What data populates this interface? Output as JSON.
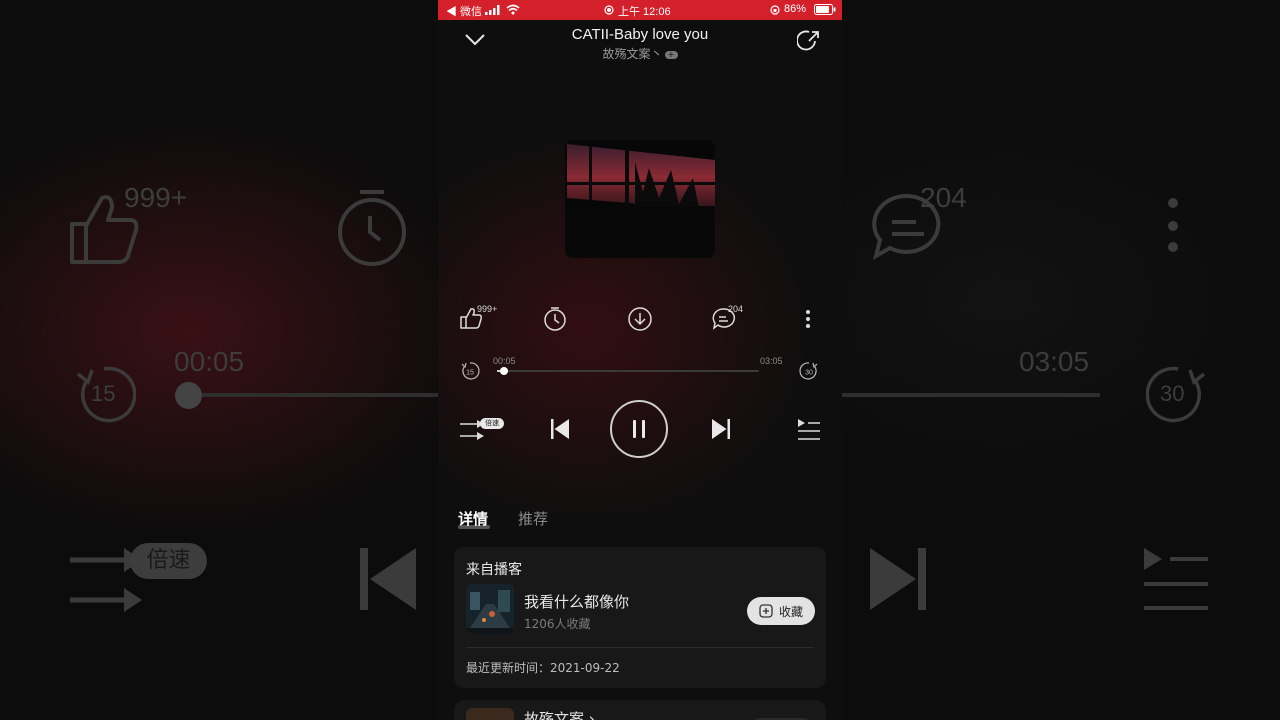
{
  "status_bar": {
    "back_app": "◀ 微信",
    "time": "上午 12:06",
    "battery": "86%"
  },
  "header": {
    "song_title": "CATII-Baby love you",
    "artist": "故殇文案丶"
  },
  "actions": {
    "likes": "999+",
    "comments": "204"
  },
  "progress": {
    "current": "00:05",
    "total": "03:05",
    "fraction": 0.027,
    "rewind_seconds": "15",
    "forward_seconds": "30"
  },
  "controls": {
    "speed_label": "倍速"
  },
  "tabs": {
    "details": "详情",
    "recommend": "推荐"
  },
  "podcast_card": {
    "heading": "来自播客",
    "podcast_title": "我看什么都像你",
    "collect_count": "1206人收藏",
    "collect_button": "收藏",
    "updated": "最近更新时间：2021-09-22"
  },
  "second_card": {
    "title": "故殇文案 ›"
  },
  "background_mirror": {
    "likes": "999+",
    "comments": "204",
    "current": "00:05",
    "total": "03:05",
    "rewind": "15",
    "forward": "30",
    "speed": "倍速"
  },
  "colors": {
    "status_bar": "#d4202a",
    "accent_glow": "#5f141c"
  }
}
